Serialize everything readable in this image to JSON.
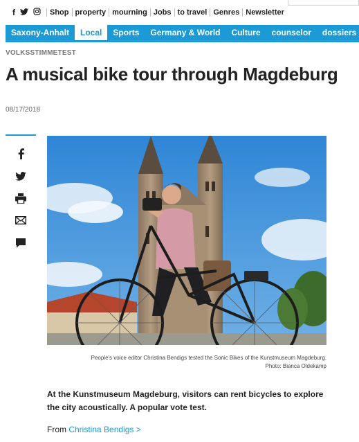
{
  "topbar": {
    "social_icons": [
      "facebook-icon",
      "twitter-icon",
      "instagram-icon"
    ],
    "links": [
      "Shop",
      "property",
      "mourning",
      "Jobs",
      "to travel",
      "Genres",
      "Newsletter"
    ]
  },
  "nav": {
    "items": [
      "Saxony-Anhalt",
      "Local",
      "Sports",
      "Germany & World",
      "Culture",
      "counselor",
      "dossiers"
    ],
    "active": "Local"
  },
  "article": {
    "kicker": "VOLKSSTIMMETEST",
    "headline": "A musical bike tour through Magdeburg",
    "date": "08/17/2018",
    "caption": "People's voice editor Christina Bendigs tested the Sonic Bikes of the Kunstmuseum Magdeburg. Photo: Bianca Oldekamp",
    "teaser": "At the Kunstmuseum Magdeburg, visitors can rent bicycles to explore the city acoustically. A popular vote test.",
    "byline_prefix": "From",
    "author": "Christina Bendigs >"
  },
  "share": [
    "facebook-icon",
    "twitter-icon",
    "print-icon",
    "mail-icon",
    "comment-icon"
  ],
  "colors": {
    "accent": "#1b9ad6",
    "text": "#222222"
  }
}
